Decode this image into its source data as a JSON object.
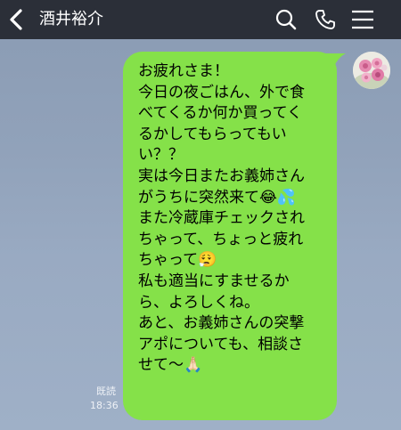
{
  "header": {
    "contact_name": "酒井裕介",
    "icons": [
      "back-chevron-icon",
      "search-icon",
      "phone-icon",
      "menu-icon"
    ]
  },
  "chat": {
    "message": {
      "lines": [
        "お疲れさま！",
        "今日の夜ごはん、外で食",
        "べてくるか何か買ってく",
        "るかしてもらってもい",
        "い？？",
        "実は今日またお義姉さん",
        "がうちに突然来て😂💦",
        "また冷蔵庫チェックされ",
        "ちゃって、ちょっと疲れ",
        "ちゃって😮‍💨",
        "私も適当にすませるか",
        "ら、よろしくね。",
        "あと、お義姉さんの突撃",
        "アポについても、相談さ",
        "せて〜🙏🏻"
      ],
      "read_status": "既読",
      "time": "18:36"
    }
  },
  "colors": {
    "header_bg": "#2b2f38",
    "bubble": "#85e149",
    "chat_bg": "#93a4bc"
  }
}
